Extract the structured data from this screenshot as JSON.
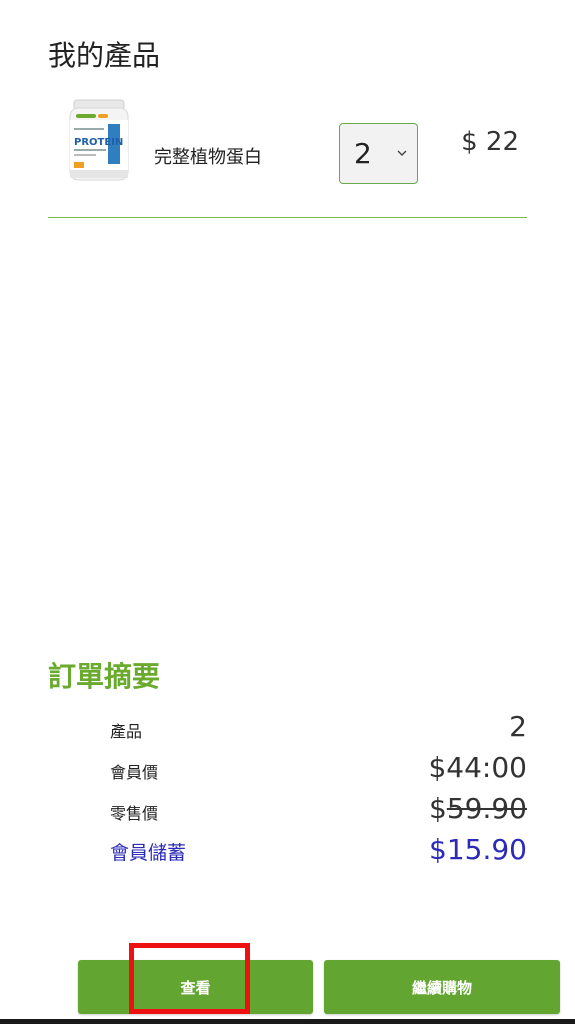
{
  "page": {
    "title": "我的產品"
  },
  "cart": {
    "items": [
      {
        "name": "完整植物蛋白",
        "quantity": "2",
        "price": "$ 22",
        "thumbnail_icon": "protein-jar-image",
        "thumbnail_brand": "PROTEIN"
      }
    ]
  },
  "summary": {
    "title": "訂單摘要",
    "products_label": "產品",
    "products_value": "2",
    "member_price_label": "會員價",
    "member_price_value": "$44:00",
    "retail_price_label": "零售價",
    "retail_price_currency": "$",
    "retail_price_value": "59.90",
    "savings_label": "會員儲蓄",
    "savings_value": "$15.90"
  },
  "actions": {
    "view_label": "查看",
    "continue_label": "繼續購物"
  },
  "colors": {
    "accent_green": "#63a531",
    "title_green": "#6aaa2e",
    "savings_blue": "#2b2bb8",
    "highlight_red": "#ee1111"
  }
}
